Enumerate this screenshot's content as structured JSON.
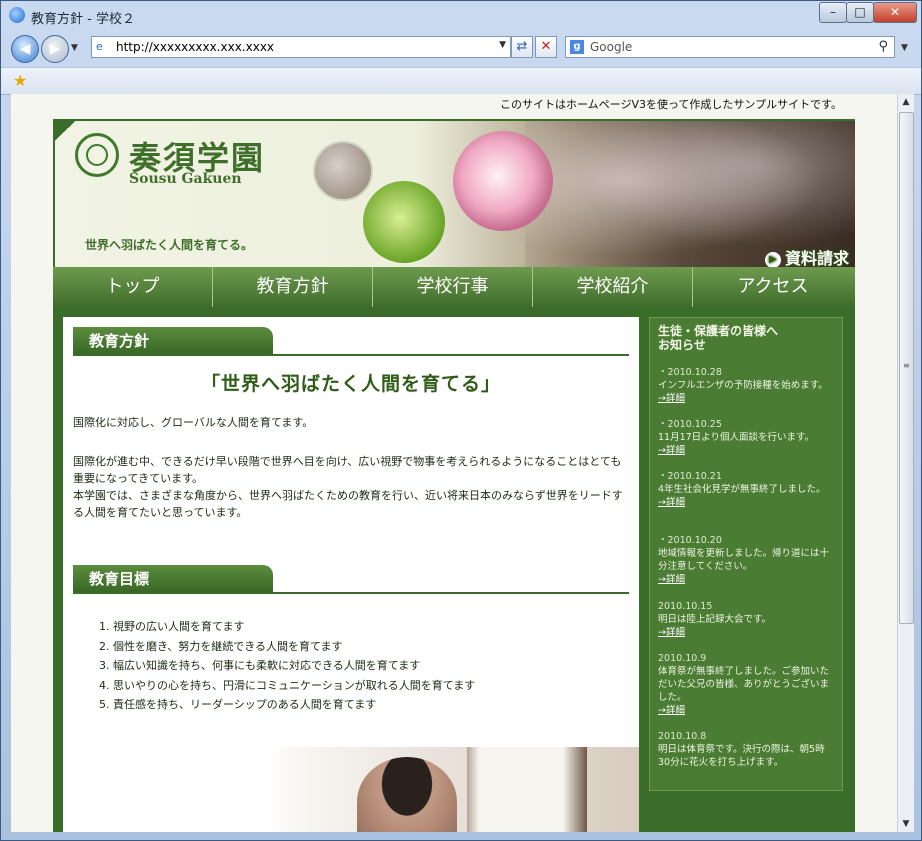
{
  "browser": {
    "title": "教育方針 - 学校２",
    "address": "http://xxxxxxxxx.xxx.xxxx",
    "search_placeholder": "Google",
    "buttons": {
      "minimize": "–",
      "maximize": "□",
      "close": "✕"
    }
  },
  "page": {
    "notice": "このサイトはホームページV3を使って作成したサンプルサイトです。",
    "logo": {
      "name": "奏須学園",
      "roman": "Sousu Gakuen"
    },
    "tagline": "世界へ羽ばたく人間を育てる。",
    "request_label": "資料請求",
    "menu": [
      "トップ",
      "教育方針",
      "学校行事",
      "学校紹介",
      "アクセス"
    ],
    "section1": {
      "title": "教育方針",
      "motto": "「世界へ羽ばたく人間を育てる」",
      "intro": "国際化に対応し、グローバルな人間を育てます。",
      "body1": "国際化が進む中、できるだけ早い段階で世界へ目を向け、広い視野で物事を考えられるようになることはとても重要になってきています。",
      "body2": "本学園では、さまざまな角度から、世界へ羽ばたくための教育を行い、近い将来日本のみならず世界をリードする人間を育てたいと思っています。"
    },
    "section2": {
      "title": "教育目標",
      "goals": [
        "視野の広い人間を育てます",
        "個性を磨き、努力を継続できる人間を育てます",
        "幅広い知識を持ち、何事にも柔軟に対応できる人間を育てます",
        "思いやりの心を持ち、円滑にコミュニケーションが取れる人間を育てます",
        "責任感を持ち、リーダーシップのある人間を育てます"
      ]
    },
    "sidebar": {
      "title": "生徒・保護者の皆様へ\nお知らせ",
      "more_label": "→詳細",
      "news": [
        {
          "date": "・2010.10.28",
          "text": "インフルエンザの予防接種を始めます。"
        },
        {
          "date": "・2010.10.25",
          "text": "11月17日より個人面談を行います。"
        },
        {
          "date": "・2010.10.21",
          "text": "4年生社会化見学が無事終了しました。"
        },
        {
          "date": "・2010.10.20",
          "text": "地域情報を更新しました。帰り道には十分注意してください。"
        },
        {
          "date": "2010.10.15",
          "text": "明日は陸上記録大会です。"
        },
        {
          "date": "2010.10.9",
          "text": "体育祭が無事終了しました。ご参加いただいた父兄の皆様、ありがとうございました。"
        },
        {
          "date": "2010.10.8",
          "text": "明日は体育祭です。決行の際は、朝5時30分に花火を打ち上げます。"
        }
      ]
    }
  }
}
